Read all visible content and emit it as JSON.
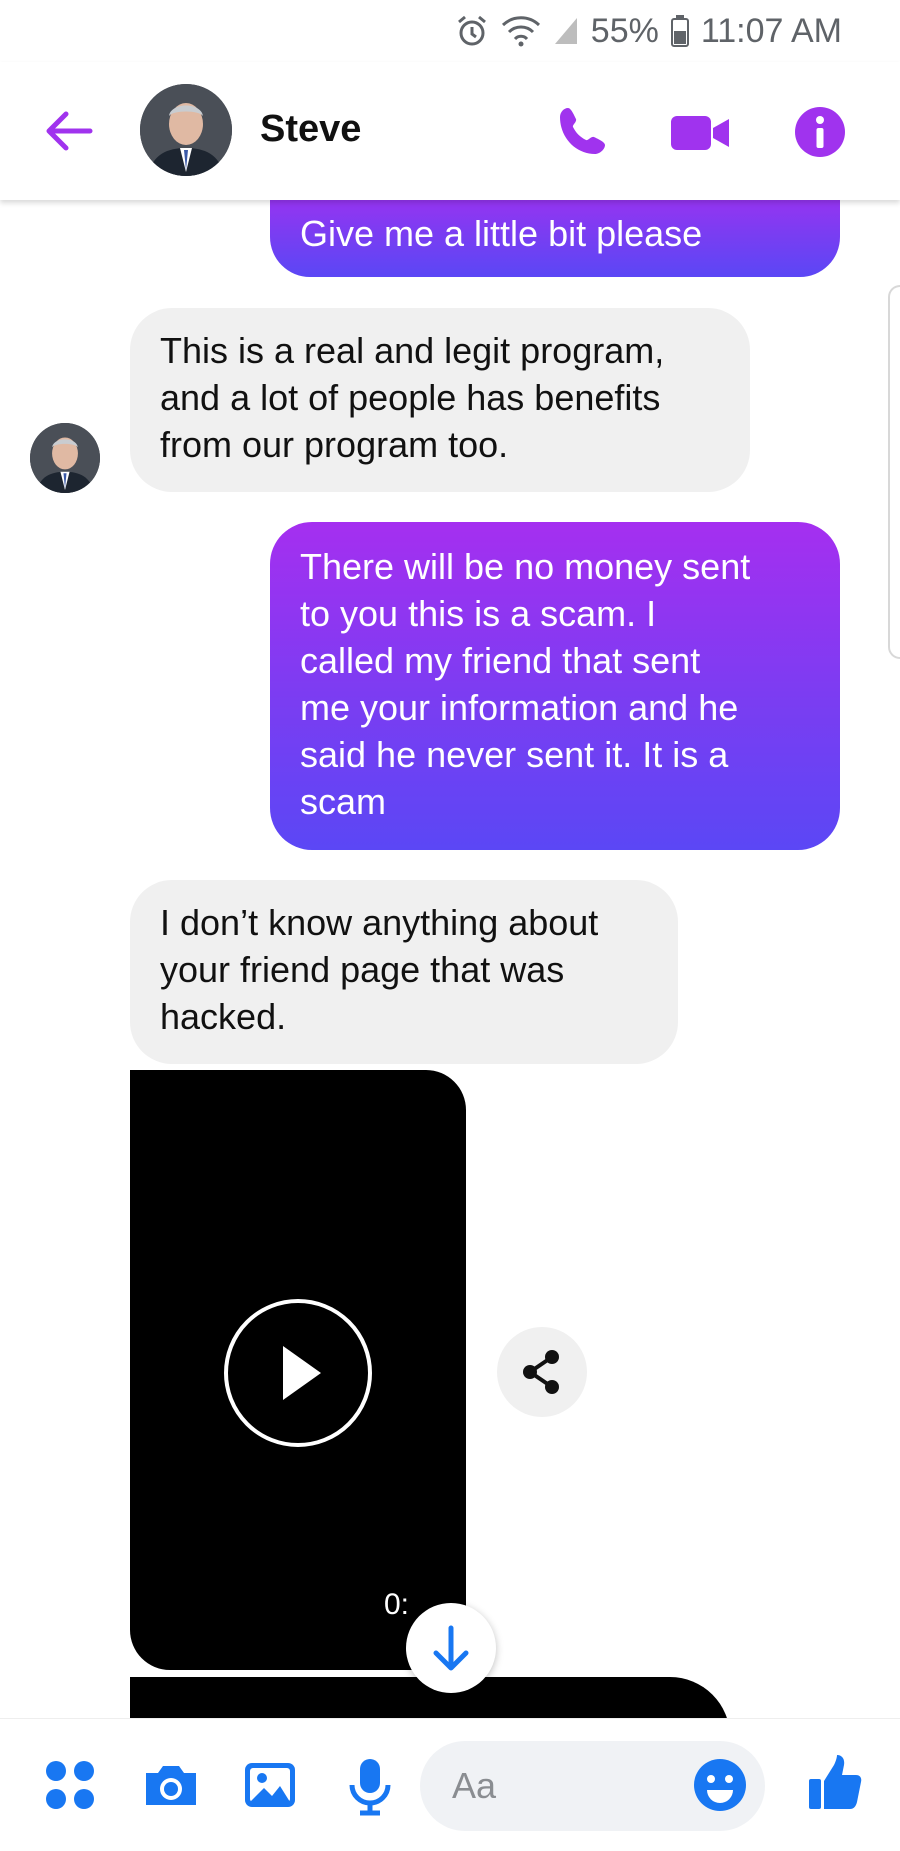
{
  "status_bar": {
    "battery": "55%",
    "time": "11:07 AM"
  },
  "header": {
    "name": "Steve"
  },
  "messages": [
    {
      "from": "me",
      "text": "Give me a little bit please"
    },
    {
      "from": "steve",
      "text": "This is a real and legit program,\nand a lot of people has benefits\nfrom our program too."
    },
    {
      "from": "me",
      "text": "There will be no money sent\nto you this is a scam. I\ncalled my friend that sent\nme your information and he\nsaid he never sent it. It is a\nscam"
    },
    {
      "from": "steve",
      "text": "I don’t know anything about\nyour friend page that was\nhacked."
    }
  ],
  "video": {
    "duration_partial": "0:"
  },
  "composer": {
    "placeholder": "Aa"
  },
  "icons": {
    "header": [
      "back-arrow-icon",
      "phone-icon",
      "video-camera-icon",
      "info-icon"
    ],
    "composer": [
      "apps-icon",
      "camera-icon",
      "gallery-icon",
      "microphone-icon",
      "emoji-icon",
      "thumbs-up-icon"
    ],
    "chat": [
      "play-icon",
      "share-icon",
      "scroll-down-icon"
    ]
  },
  "colors": {
    "accent_purple": "#a033ee",
    "composer_blue": "#1877f2",
    "incoming_bubble": "#f0f0f0"
  }
}
